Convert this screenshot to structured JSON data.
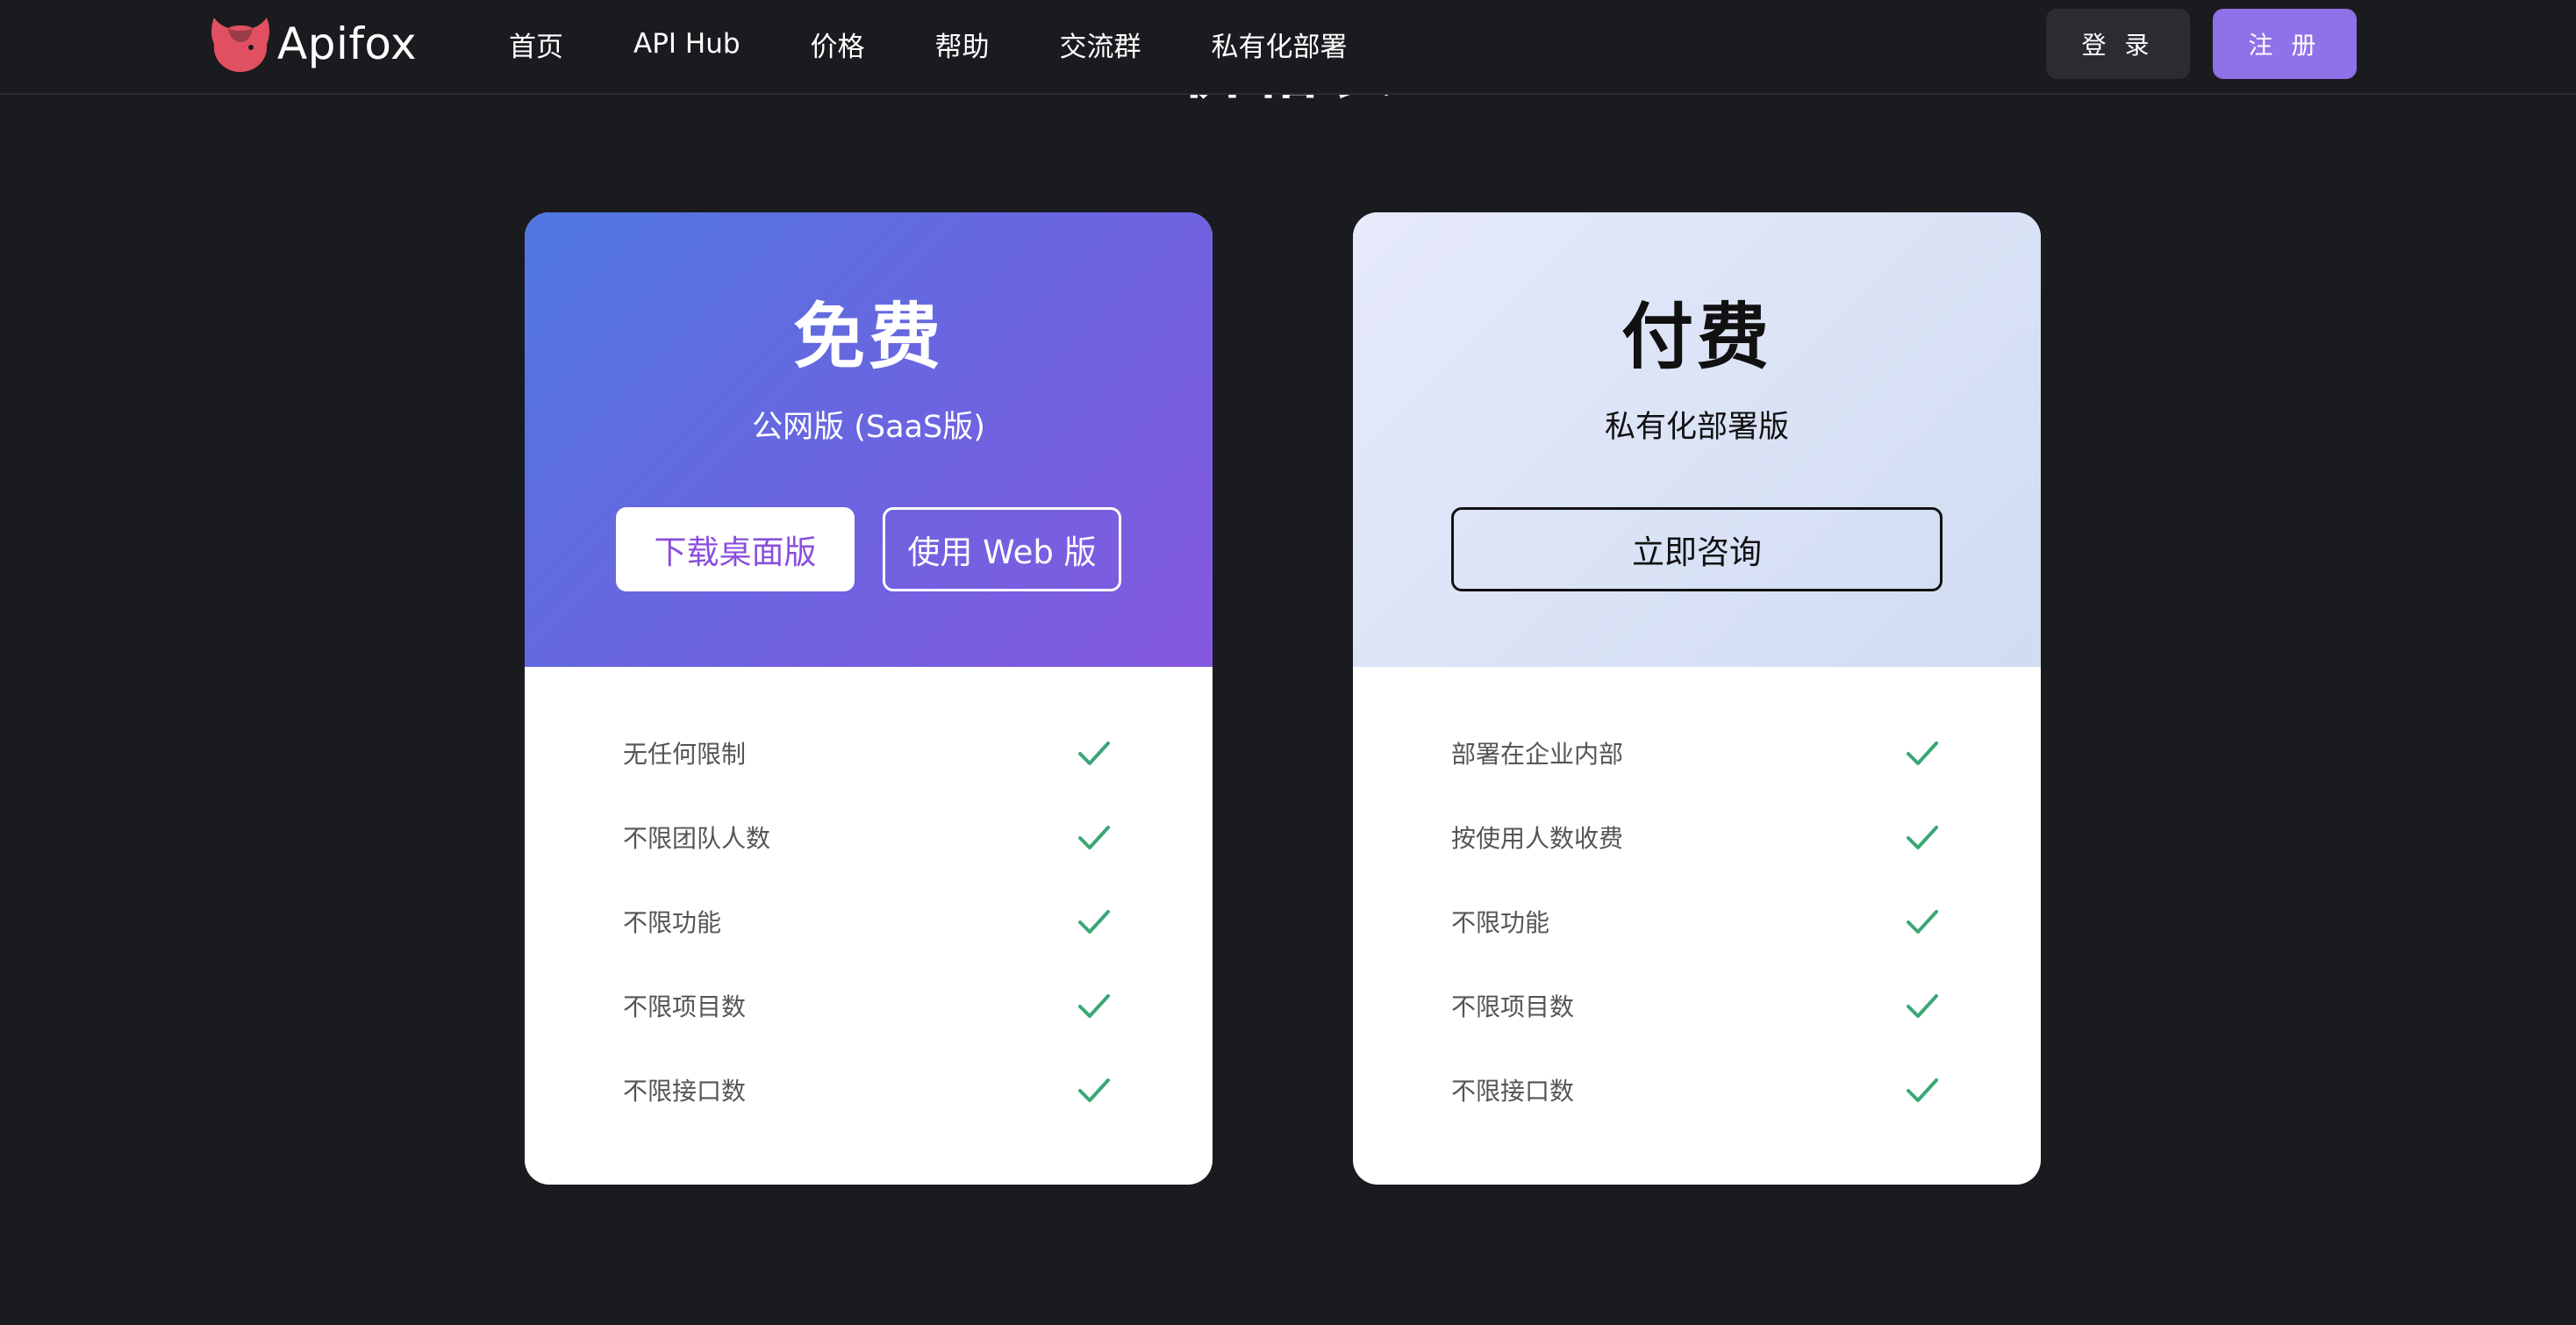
{
  "page": {
    "section_title": "价格表"
  },
  "navbar": {
    "logo_text": "Apifox",
    "links": [
      {
        "label": "首页"
      },
      {
        "label": "API Hub"
      },
      {
        "label": "价格"
      },
      {
        "label": "帮助"
      },
      {
        "label": "交流群"
      },
      {
        "label": "私有化部署"
      }
    ],
    "login_label": "登 录",
    "register_label": "注 册"
  },
  "plans": {
    "free": {
      "name": "免费",
      "subtitle": "公网版 (SaaS版)",
      "download_label": "下载桌面版",
      "web_label": "使用 Web 版",
      "features": [
        {
          "label": "无任何限制"
        },
        {
          "label": "不限团队人数"
        },
        {
          "label": "不限功能"
        },
        {
          "label": "不限项目数"
        },
        {
          "label": "不限接口数"
        }
      ]
    },
    "paid": {
      "name": "付费",
      "subtitle": "私有化部署版",
      "consult_label": "立即咨询",
      "features": [
        {
          "label": "部署在企业内部"
        },
        {
          "label": "按使用人数收费"
        },
        {
          "label": "不限功能"
        },
        {
          "label": "不限项目数"
        },
        {
          "label": "不限接口数"
        }
      ]
    }
  },
  "colors": {
    "page_background": "#1a1b1f",
    "brand_accent": "#8f71e8",
    "free_gradient_start": "#4f78e0",
    "free_gradient_end": "#8558e0",
    "download_text": "#8a4fdc",
    "check": "#3aa776",
    "logo": "#e05060"
  },
  "icons": {
    "logo": "apifox-logo-icon",
    "feature_check": "check-icon"
  }
}
